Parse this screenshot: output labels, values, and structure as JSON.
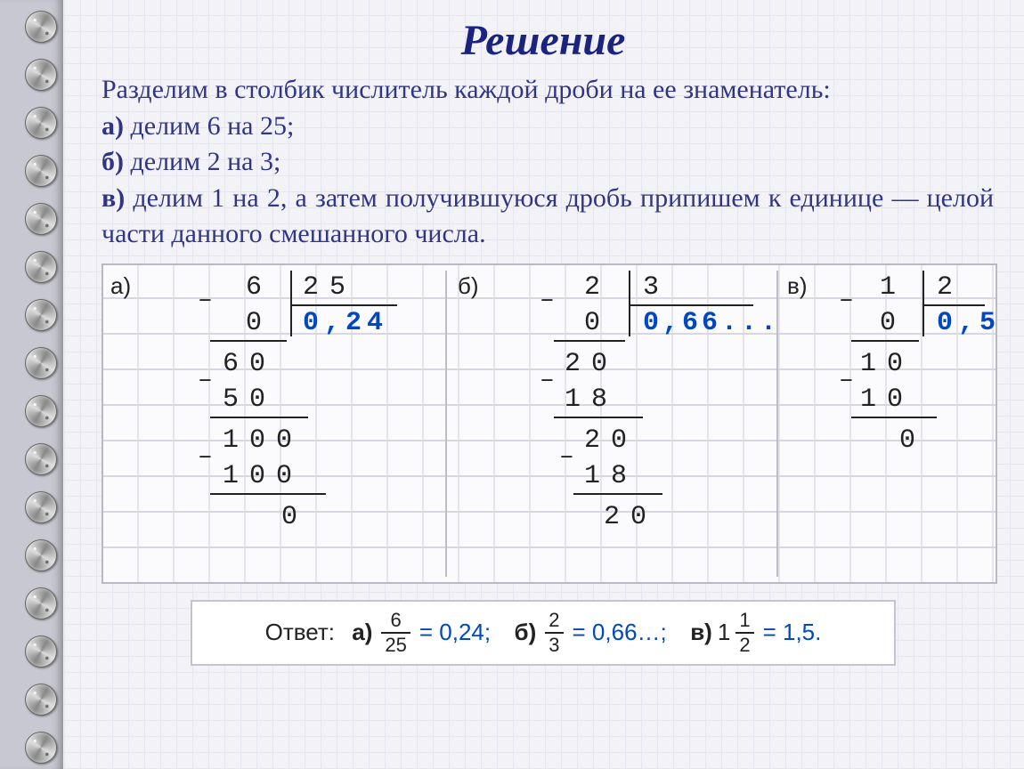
{
  "title": "Решение",
  "intro": "Разделим в столбик числитель каждой дроби на ее знаменатель:",
  "items": {
    "a_label": "а)",
    "a_text": " делим 6 на 25;",
    "b_label": "б)",
    "b_text": " делим 2 на 3;",
    "c_label": "в)",
    "c_text": " делим 1 на 2, а затем получившуюся дробь припишем к единице — целой части данного смешанного числа."
  },
  "work": {
    "a": {
      "label": "а)",
      "dividend": "6",
      "divisor": "25",
      "quotient": "0,24",
      "rows": [
        "0",
        "60",
        "50",
        "100",
        "100",
        "0"
      ]
    },
    "b": {
      "label": "б)",
      "dividend": "2",
      "divisor": "3",
      "quotient": "0,66...",
      "rows": [
        "0",
        "20",
        "18",
        "20",
        "18",
        "20"
      ]
    },
    "c": {
      "label": "в)",
      "dividend": "1",
      "divisor": "2",
      "quotient": "0,5",
      "rows": [
        "0",
        "10",
        "10",
        "0"
      ]
    }
  },
  "answer": {
    "prefix": "Ответ:",
    "a_lab": "а)",
    "a_num": "6",
    "a_den": "25",
    "a_eq": "= 0,24;",
    "b_lab": "б)",
    "b_num": "2",
    "b_den": "3",
    "b_eq": "= 0,66…;",
    "c_lab": "в)",
    "c_whole": "1",
    "c_num": "1",
    "c_den": "2",
    "c_eq": "= 1,5."
  }
}
